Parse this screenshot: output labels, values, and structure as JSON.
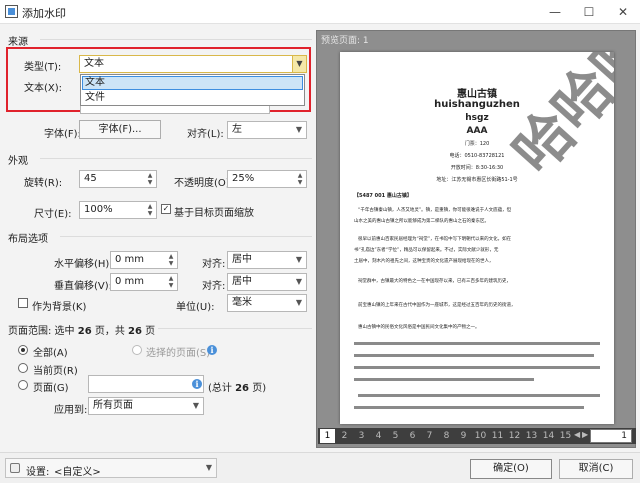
{
  "window": {
    "title": "添加水印",
    "minimize": "—",
    "maximize": "☐",
    "close": "✕"
  },
  "source": {
    "title": "来源",
    "type_label": "类型(T):",
    "type_value": "文本",
    "type_options": [
      "文本",
      "文件"
    ],
    "text_label": "文本(X):",
    "font_label": "字体(F):",
    "font_button": "字体(F)...",
    "align_label": "对齐(L):",
    "align_value": "左"
  },
  "appearance": {
    "title": "外观",
    "rotation_label": "旋转(R):",
    "rotation_value": "45",
    "opacity_label": "不透明度(O):",
    "opacity_value": "25%",
    "size_label": "尺寸(E):",
    "size_value": "100%",
    "scale_checkbox": "基于目标页面缩放",
    "scale_checked": true
  },
  "layout": {
    "title": "布局选项",
    "h_offset_label": "水平偏移(H):",
    "h_offset_value": "0 mm",
    "h_align_label": "对齐:",
    "h_align_value": "居中",
    "v_offset_label": "垂直偏移(V):",
    "v_offset_value": "0 mm",
    "v_align_label": "对齐:",
    "v_align_value": "居中",
    "background_checkbox": "作为背景(K)",
    "background_checked": false,
    "unit_label": "单位(U):",
    "unit_value": "毫米"
  },
  "page_range": {
    "title_prefix": "页面范围: 选中",
    "selected_count": "26",
    "title_mid": "页，共",
    "total_count": "26",
    "title_suffix": "页",
    "all_label": "全部(A)",
    "selected_pages_label": "选择的页面(S)",
    "current_label": "当前页(R)",
    "pages_label": "页面(G)",
    "pages_value": "",
    "total_prefix": "(总计",
    "total_value": "26",
    "total_suffix": "页)",
    "apply_label": "应用到:",
    "apply_value": "所有页面"
  },
  "preview": {
    "title": "预览页面: 1",
    "doc_title": "惠山古镇",
    "doc_pinyin": "huishanguzhen",
    "doc_abbr": "hsgz",
    "doc_rating": "AAA",
    "doc_ticket": "门票：120",
    "doc_phone": "电话：0510-83728121",
    "doc_hours": "开放时间：8:30-16:30",
    "doc_address": "地址：江苏无锡市惠区长街路51-1号",
    "doc_section": "【5487 001 惠山古镇】",
    "doc_para1": "“千年古镇秦山镇，人杰又地灵”。镇，是重镇，你可能很难说于人文底蕴，但",
    "doc_para1b": "山水之美的惠山古镇之所以能够成为第二梯队的惠山之石的秦东区。",
    "doc_para2": "很早以前惠山百家民居经理为“祠堂”，在书馆中写下明朝代以来的文化，如在",
    "doc_para2b": "书“孔庙边”东者“学位”，精品可以保留起来。不过，实际文献少就形，无",
    "doc_para2c": "土居中，刻木片的祖先之间，这种宝贵的文化遗产展现给现在的世人，",
    "doc_para3": "祠堂群中，古镇最大的特色之一在中国现存以来，已有三百多年的建筑历史，",
    "doc_para4": "前宝惠山镇的上年来在古代中国作为一座城市，这是经过五百年的历史的街道，",
    "doc_para5": "惠山古镇中的民俗文化风俗是中国民间文化集中的产物之一。",
    "watermark": "哈哈哈",
    "pages": [
      "1",
      "2",
      "3",
      "4",
      "5",
      "6",
      "7",
      "8",
      "9",
      "10",
      "11",
      "12",
      "13",
      "14",
      "15"
    ],
    "page_input": "1",
    "nav_prev": "◀",
    "nav_next": "▶"
  },
  "footer": {
    "settings_label": "设置:",
    "settings_value": "<自定义>",
    "ok_button": "确定(O)",
    "cancel_button": "取消(C)"
  }
}
